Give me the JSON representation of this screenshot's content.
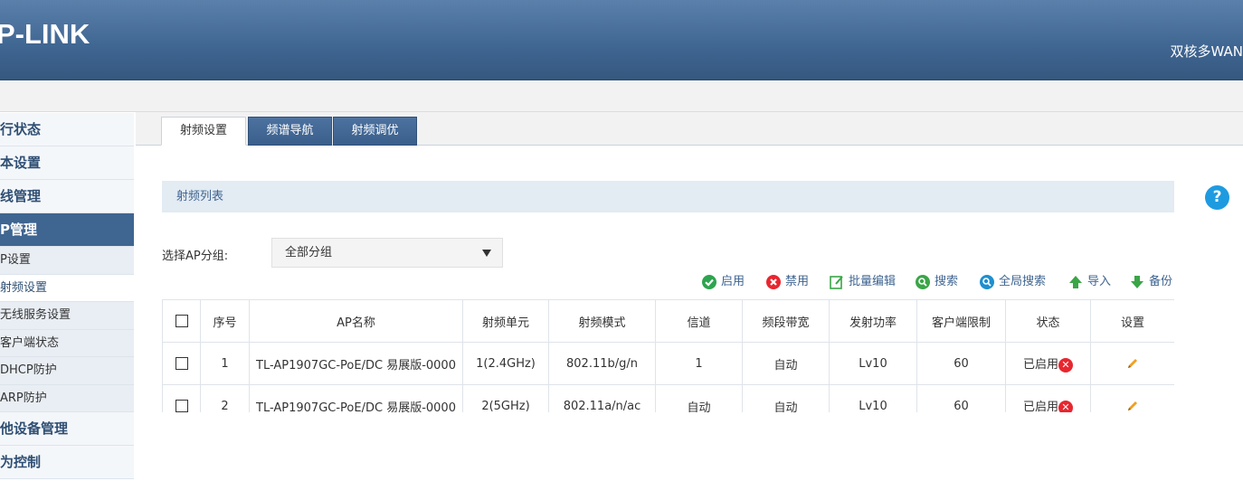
{
  "header": {
    "logo": "P-LINK",
    "product": "双核多WAN"
  },
  "sidebar": {
    "items": [
      {
        "label": "行状态",
        "type": "main"
      },
      {
        "label": "本设置",
        "type": "main"
      },
      {
        "label": "线管理",
        "type": "main"
      },
      {
        "label": "P管理",
        "type": "main",
        "active": true
      },
      {
        "label": "P设置",
        "type": "sub"
      },
      {
        "label": "射频设置",
        "type": "sub",
        "active": true
      },
      {
        "label": "无线服务设置",
        "type": "sub"
      },
      {
        "label": "客户端状态",
        "type": "sub"
      },
      {
        "label": "DHCP防护",
        "type": "sub"
      },
      {
        "label": "ARP防护",
        "type": "sub"
      },
      {
        "label": "他设备管理",
        "type": "main"
      },
      {
        "label": "为控制",
        "type": "main"
      }
    ]
  },
  "tabs": [
    {
      "label": "射频设置",
      "active": true
    },
    {
      "label": "频谱导航",
      "active": false
    },
    {
      "label": "射频调优",
      "active": false
    }
  ],
  "help": {
    "label": "?"
  },
  "section": {
    "title": "射频列表"
  },
  "group": {
    "label": "选择AP分组:",
    "value": "全部分组"
  },
  "toolbar": {
    "enable": "启用",
    "disable": "禁用",
    "batch_edit": "批量编辑",
    "search": "搜索",
    "global_search": "全局搜索",
    "import": "导入",
    "backup": "备份"
  },
  "table": {
    "columns": [
      "序号",
      "AP名称",
      "射频单元",
      "射频模式",
      "信道",
      "频段带宽",
      "发射功率",
      "客户端限制",
      "状态",
      "设置"
    ],
    "rows": [
      {
        "index": "1",
        "name": "TL-AP1907GC-PoE/DC 易展版-0000",
        "unit": "1(2.4GHz)",
        "mode": "802.11b/g/n",
        "channel": "1",
        "bandwidth": "自动",
        "power": "Lv10",
        "limit": "60",
        "status": "已启用"
      },
      {
        "index": "2",
        "name": "TL-AP1907GC-PoE/DC 易展版-0000",
        "unit": "2(5GHz)",
        "mode": "802.11a/n/ac",
        "channel": "自动",
        "bandwidth": "自动",
        "power": "Lv10",
        "limit": "60",
        "status": "已启用"
      }
    ]
  },
  "colors": {
    "header": "#3f6591",
    "accent": "#1e9be0",
    "danger": "#e8262f",
    "success": "#2ea44f"
  }
}
